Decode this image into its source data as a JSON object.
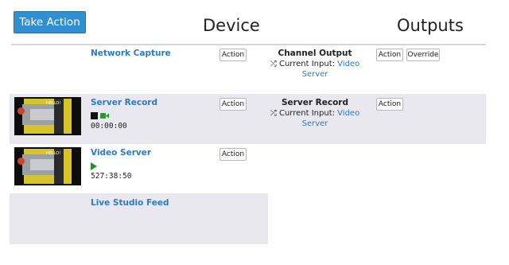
{
  "header": {
    "take_action_label": "Take Action",
    "devices_title": "Devices",
    "outputs_title": "Outputs"
  },
  "devices": [
    {
      "name": "Network Capture",
      "action_label": "Action"
    },
    {
      "name": "Server Record",
      "action_label": "Action",
      "time": "00:00:00",
      "thumbnail_text": "HELLO!"
    },
    {
      "name": "Video Server",
      "action_label": "Action",
      "time": "527:38:50",
      "thumbnail_text": "HELLO!"
    },
    {
      "name": "Live Studio Feed"
    }
  ],
  "outputs": [
    {
      "name": "Channel Output",
      "current_input_label": "Current Input:",
      "current_input_value_1": "Video",
      "current_input_value_2": "Server",
      "action_label": "Action",
      "override_label": "Override"
    },
    {
      "name": "Server Record",
      "current_input_label": "Current Input:",
      "current_input_value_1": "Video",
      "current_input_value_2": "Server",
      "action_label": "Action"
    }
  ],
  "icons": {
    "shuffle": "⤮",
    "stop": "stop-square",
    "camera": "video-camera",
    "play": "play-triangle"
  },
  "colors": {
    "accent": "#2f8fd0",
    "link": "#2a7bc0",
    "row_highlight": "#e8e8ee",
    "record_green": "#2a9a2a"
  }
}
